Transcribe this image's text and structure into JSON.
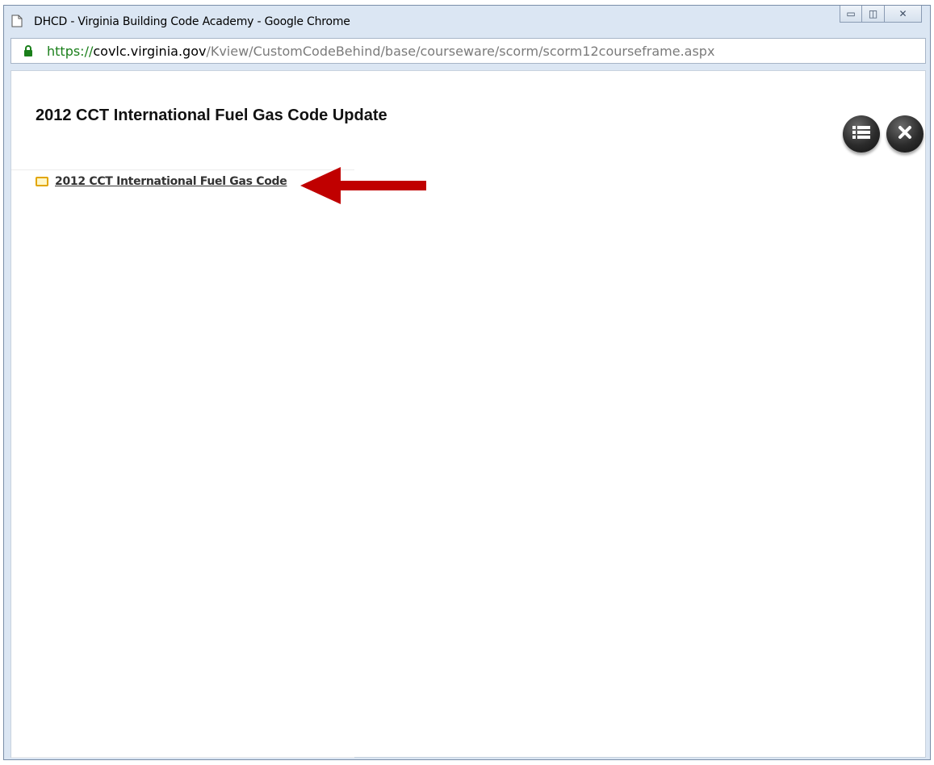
{
  "window": {
    "title": "DHCD - Virginia Building Code Academy - Google Chrome",
    "controls": {
      "minimize": "▭",
      "restore": "◫",
      "close": "✕"
    }
  },
  "address": {
    "scheme": "https://",
    "host": "covlc.virginia.gov",
    "path": "/Kview/CustomCodeBehind/base/courseware/scorm/scorm12courseframe.aspx"
  },
  "course": {
    "title": "2012 CCT International Fuel Gas Code Update",
    "toc": [
      {
        "label": "2012 CCT International Fuel Gas Code"
      }
    ]
  },
  "colors": {
    "accent_arrow": "#c00000",
    "lock": "#1a7f1a",
    "folder": "#e2a600"
  },
  "icons": [
    "page-icon",
    "lock-icon",
    "list-menu-icon",
    "close-icon",
    "folder-icon",
    "arrow-left-icon"
  ]
}
